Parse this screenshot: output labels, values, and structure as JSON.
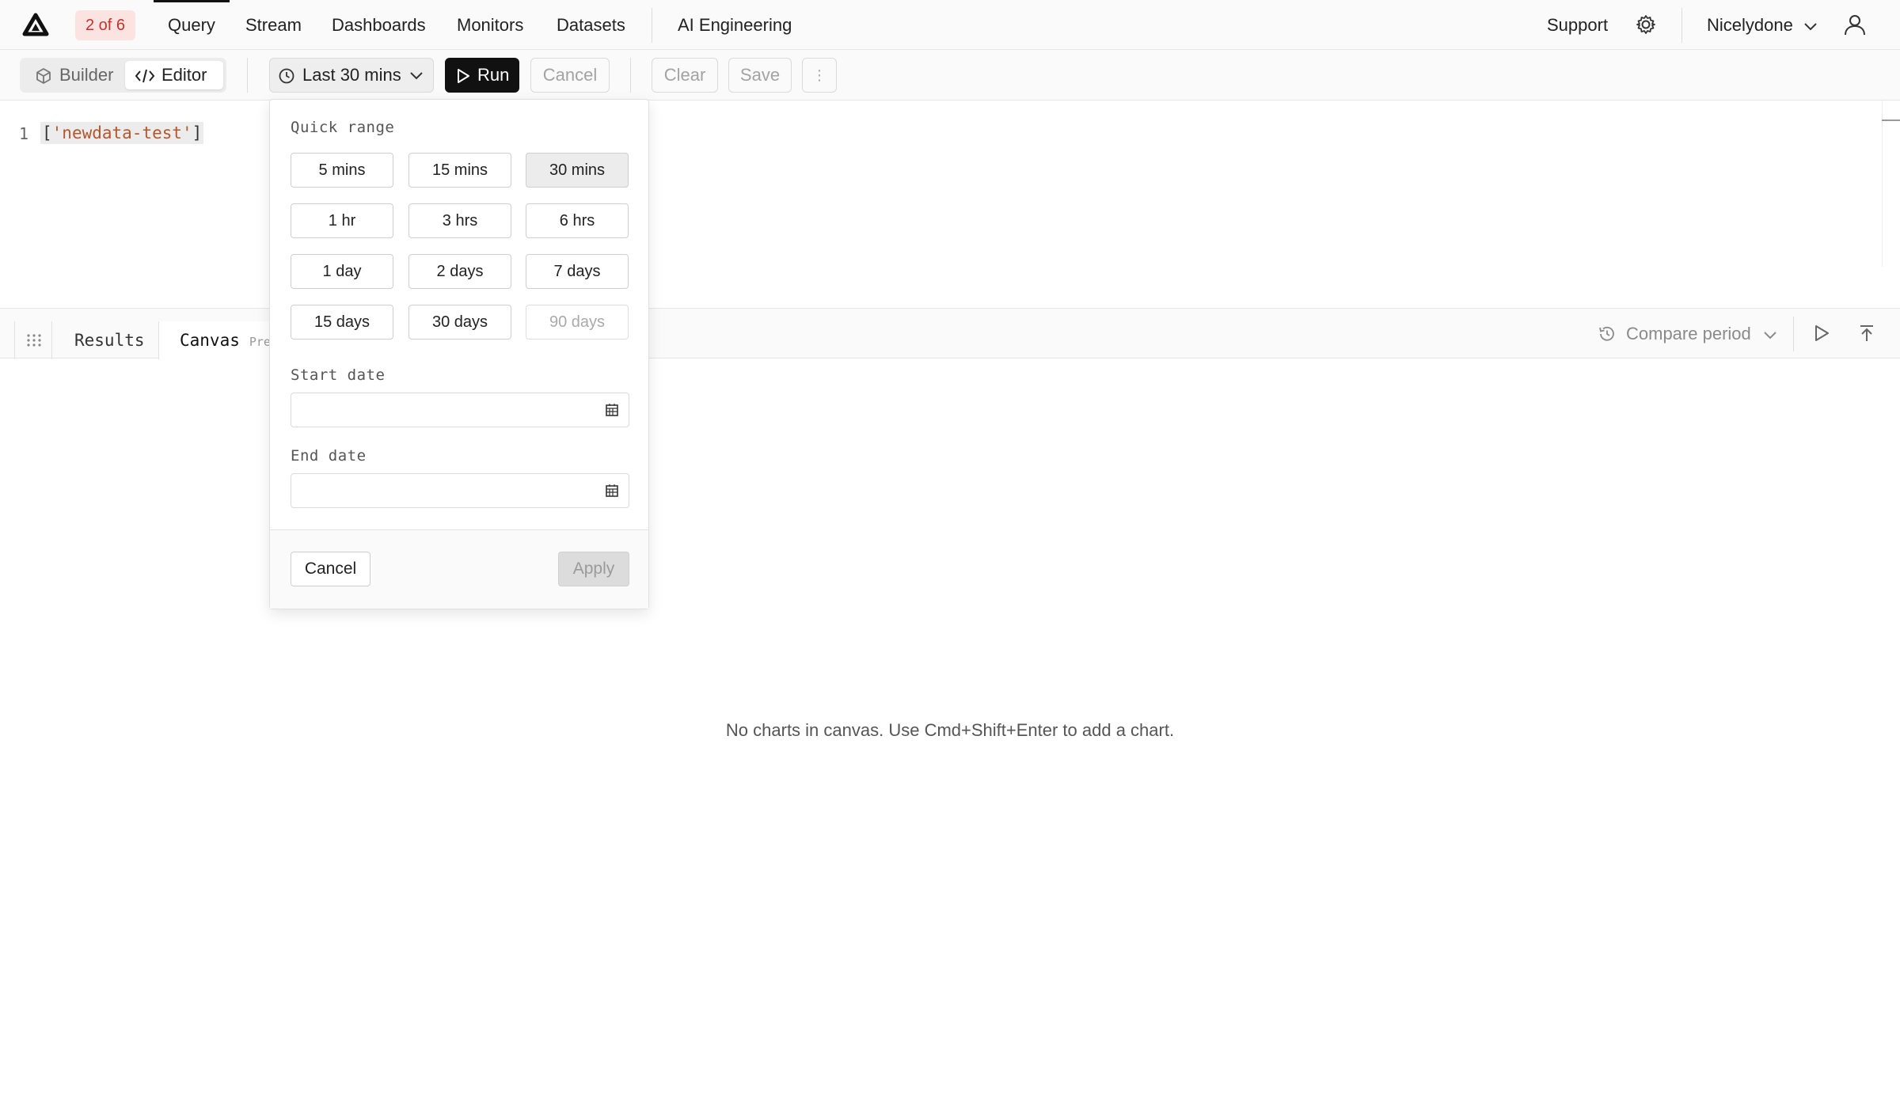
{
  "nav": {
    "badge": "2 of 6",
    "items": [
      "Query",
      "Stream",
      "Dashboards",
      "Monitors",
      "Datasets"
    ],
    "ai_engineering": "AI Engineering",
    "support": "Support",
    "org": "Nicelydone"
  },
  "toolbar": {
    "builder": "Builder",
    "editor": "Editor",
    "time_range": "Last 30 mins",
    "run": "Run",
    "cancel": "Cancel",
    "clear": "Clear",
    "save": "Save",
    "more": "⋮"
  },
  "editor": {
    "line_number": "1",
    "code_open": "[",
    "code_string": "'newdata-test'",
    "code_close": "]"
  },
  "tabs": {
    "results": "Results",
    "canvas": "Canvas",
    "canvas_badge": "Pre",
    "compare_period": "Compare period"
  },
  "canvas": {
    "empty_message": "No charts in canvas. Use Cmd+Shift+Enter to add a chart."
  },
  "dropdown": {
    "quick_range_label": "Quick range",
    "ranges": [
      {
        "label": "5 mins",
        "state": "normal"
      },
      {
        "label": "15 mins",
        "state": "normal"
      },
      {
        "label": "30 mins",
        "state": "selected"
      },
      {
        "label": "1 hr",
        "state": "normal"
      },
      {
        "label": "3 hrs",
        "state": "normal"
      },
      {
        "label": "6 hrs",
        "state": "normal"
      },
      {
        "label": "1 day",
        "state": "normal"
      },
      {
        "label": "2 days",
        "state": "normal"
      },
      {
        "label": "7 days",
        "state": "normal"
      },
      {
        "label": "15 days",
        "state": "normal"
      },
      {
        "label": "30 days",
        "state": "normal"
      },
      {
        "label": "90 days",
        "state": "disabled"
      }
    ],
    "start_date_label": "Start date",
    "start_date_value": "",
    "end_date_label": "End date",
    "end_date_value": "",
    "cancel": "Cancel",
    "apply": "Apply"
  },
  "colors": {
    "badge_bg": "#fbe3e1",
    "badge_text": "#c8312b",
    "run_bg": "#111111",
    "code_string": "#b5562b"
  }
}
